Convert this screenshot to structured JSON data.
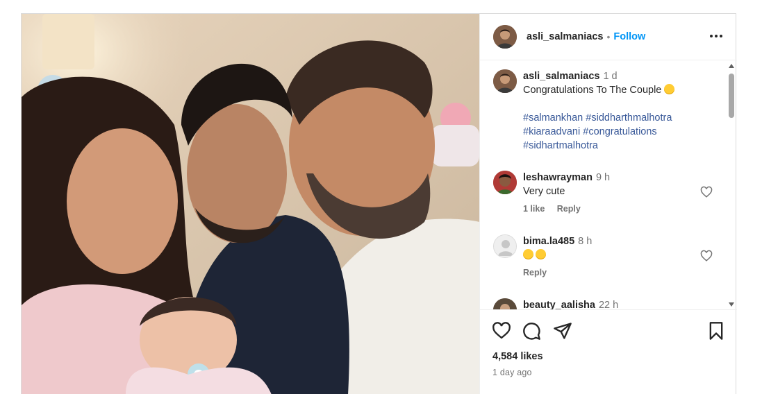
{
  "post": {
    "username": "asli_salmaniacs",
    "separator": "•",
    "follow_label": "Follow",
    "more_icon": "more-options-icon"
  },
  "caption": {
    "username": "asli_salmaniacs",
    "time": "1 d",
    "text": "Congratulations To The Couple",
    "emoji": "smiling-face-with-hearts-emoji",
    "hashtags": [
      "#salmankhan",
      "#siddharthmalhotra",
      "#kiaraadvani",
      "#congratulations",
      "#sidhartmalhotra"
    ]
  },
  "comments": [
    {
      "username": "leshawrayman",
      "time": "9 h",
      "text": "Very cute",
      "likes": "1 like",
      "reply": "Reply"
    },
    {
      "username": "bima.la485",
      "time": "8 h",
      "text": "",
      "emoji": "star-struck-emoji x2",
      "reply": "Reply"
    },
    {
      "username": "beauty_aalisha",
      "time": "22 h"
    }
  ],
  "footer": {
    "likes": "4,584 likes",
    "ago": "1 day ago"
  },
  "colors": {
    "accent": "#0095f6",
    "hashtag": "#385898",
    "muted": "#737373",
    "border": "#dbdbdb"
  }
}
